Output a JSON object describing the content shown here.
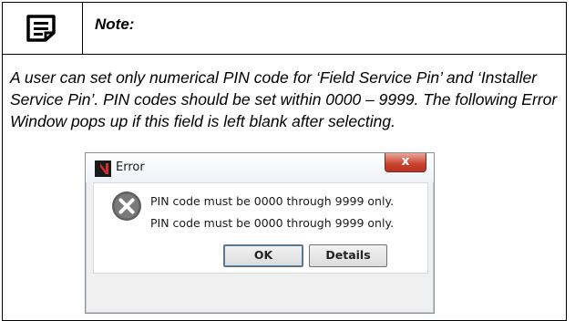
{
  "note": {
    "title": "Note:",
    "icon": "note-document-icon",
    "body": "A user can set only numerical PIN code for ‘Field Service Pin’ and ‘Installer Service Pin’. PIN codes should be set within 0000 – 9999. The following Error Window pops up if this field is left blank after selecting."
  },
  "error_window": {
    "title": "Error",
    "close_label": "x",
    "app_icon": "app-logo-icon",
    "error_icon": "error-x-icon",
    "messages": [
      "PIN code must be 0000 through 9999 only.",
      "PIN code must be 0000 through 9999 only."
    ],
    "ok_label": "OK",
    "details_label": "Details"
  },
  "colors": {
    "close_button": "#c8412d",
    "error_icon": "#6b6b6b"
  }
}
